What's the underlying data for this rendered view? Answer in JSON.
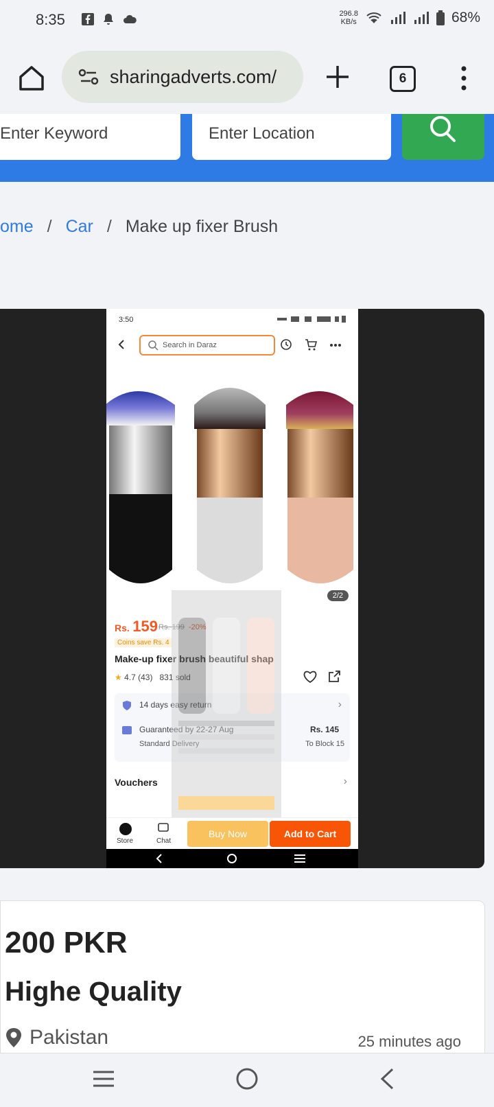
{
  "status_bar": {
    "time": "8:35",
    "net_speed_value": "296.8",
    "net_speed_unit": "KB/s",
    "battery": "68%"
  },
  "browser": {
    "url": "sharingadverts.com/",
    "tab_count": "6"
  },
  "search": {
    "keyword_placeholder": "Enter Keyword",
    "location_placeholder": "Enter Location"
  },
  "breadcrumb": {
    "home": "ome",
    "category": "Car",
    "current": "Make up fixer Brush"
  },
  "screenshot": {
    "time": "3:50",
    "search_placeholder": "Search in Daraz",
    "counter": "2/2",
    "price_rs": "Rs.",
    "price": "159",
    "old_price": "Rs. 199",
    "discount": "-20%",
    "coins": "Coins save Rs. 4",
    "title": "Make-up fixer brush beautiful shap",
    "rating": "4.7 (43)",
    "sold": "831 sold",
    "return_text": "14 days easy return",
    "guarantee": "Guaranteed by 22-27 Aug",
    "delivery": "Standard Delivery",
    "delivery_price": "Rs. 145",
    "delivery_to": "To Block 15",
    "vouchers": "Vouchers",
    "store": "Store",
    "chat": "Chat",
    "buy_now": "Buy Now",
    "add_to_cart": "Add to Cart"
  },
  "listing": {
    "price": "200 PKR",
    "title": "Highe Quality",
    "location": "Pakistan",
    "posted": "25 minutes ago"
  },
  "colors": {
    "brand_blue": "#2f7be5",
    "search_green": "#33a852",
    "daraz_orange": "#f85606"
  }
}
